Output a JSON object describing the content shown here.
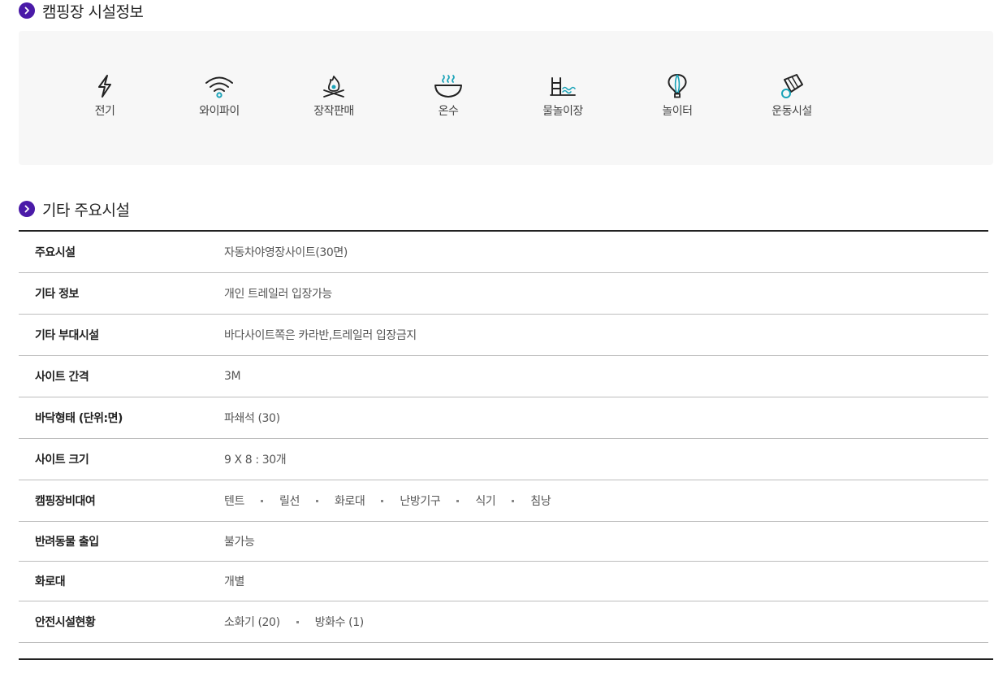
{
  "section1": {
    "title": "캠핑장 시설정보"
  },
  "facilities": [
    {
      "label": "전기",
      "icon": "lightning-icon"
    },
    {
      "label": "와이파이",
      "icon": "wifi-icon"
    },
    {
      "label": "장작판매",
      "icon": "campfire-icon"
    },
    {
      "label": "온수",
      "icon": "hot-water-icon"
    },
    {
      "label": "물놀이장",
      "icon": "pool-icon"
    },
    {
      "label": "놀이터",
      "icon": "balloon-icon"
    },
    {
      "label": "운동시설",
      "icon": "badminton-icon"
    }
  ],
  "section2": {
    "title": "기타 주요시설"
  },
  "info": {
    "main_facility": {
      "label": "주요시설",
      "value": "자동차야영장사이트(30면)"
    },
    "other_info": {
      "label": "기타 정보",
      "value": "개인 트레일러 입장가능"
    },
    "other_amenities": {
      "label": "기타 부대시설",
      "value": "바다사이트쪽은 카라반,트레일러 입장금지"
    },
    "site_spacing": {
      "label": "사이트 간격",
      "value": "3M"
    },
    "floor_type": {
      "label": "바닥형태 (단위:면)",
      "value": "파쇄석 (30)"
    },
    "site_size": {
      "label": "사이트 크기",
      "value": "9 X 8 : 30개"
    },
    "rental": {
      "label": "캠핑장비대여",
      "items": [
        "텐트",
        "릴선",
        "화로대",
        "난방기구",
        "식기",
        "침낭"
      ]
    },
    "pets": {
      "label": "반려동물 출입",
      "value": "불가능"
    },
    "firepit": {
      "label": "화로대",
      "value": "개별"
    },
    "safety": {
      "label": "안전시설현황",
      "items": [
        "소화기 (20)",
        "방화수 (1)"
      ]
    }
  },
  "colors": {
    "accent": "#4a1aa8",
    "icon_teal": "#1ba3b8",
    "icon_dark": "#222222"
  }
}
